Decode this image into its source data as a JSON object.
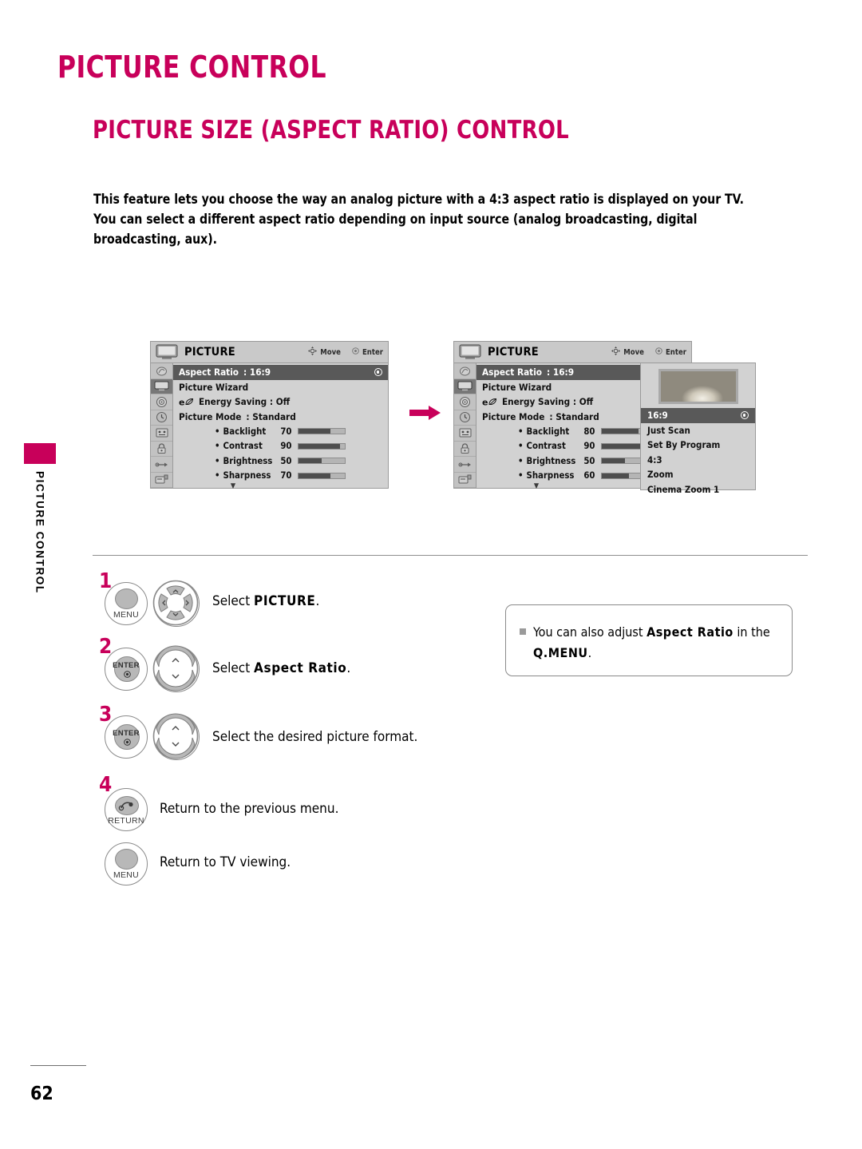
{
  "page": {
    "chapter_title": "PICTURE CONTROL",
    "section_title": "PICTURE SIZE (ASPECT RATIO) CONTROL",
    "page_number": "62",
    "side_tab": "PICTURE CONTROL",
    "accent_color": "#C8005A"
  },
  "intro": {
    "line1": "This feature lets you choose the way an analog picture with a 4:3 aspect ratio is displayed on your TV.",
    "line2": "You can select a different aspect ratio depending on input source (analog broadcasting, digital broadcasting, aux)."
  },
  "osd1": {
    "title": "PICTURE",
    "hint_move": "Move",
    "hint_enter": "Enter",
    "rows": [
      {
        "label": "Aspect Ratio",
        "value": ": 16:9",
        "selected": true
      },
      {
        "label": "Picture Wizard",
        "value": "",
        "selected": false
      },
      {
        "label": "Energy Saving : Off",
        "value": "",
        "selected": false,
        "eco": true
      },
      {
        "label": "Picture Mode",
        "value": ": Standard",
        "selected": false
      }
    ],
    "sliders": [
      {
        "name": "Backlight",
        "value": "70",
        "percent": 70
      },
      {
        "name": "Contrast",
        "value": "90",
        "percent": 90
      },
      {
        "name": "Brightness",
        "value": "50",
        "percent": 50
      },
      {
        "name": "Sharpness",
        "value": "70",
        "percent": 70
      }
    ],
    "more_indicator": "▼",
    "sidebar_icons": [
      "channel-icon",
      "picture-icon",
      "audio-icon",
      "time-icon",
      "option-icon",
      "lock-icon",
      "input-icon",
      "usb-icon"
    ]
  },
  "osd2": {
    "title": "PICTURE",
    "hint_move": "Move",
    "hint_enter": "Enter",
    "rows": [
      {
        "label": "Aspect Ratio",
        "value": ": 16:9",
        "selected": true
      },
      {
        "label": "Picture Wizard",
        "value": "",
        "selected": false
      },
      {
        "label": "Energy Saving : Off",
        "value": "",
        "selected": false,
        "eco": true
      },
      {
        "label": "Picture Mode",
        "value": ": Standard",
        "selected": false
      }
    ],
    "sliders": [
      {
        "name": "Backlight",
        "value": "80",
        "percent": 80
      },
      {
        "name": "Contrast",
        "value": "90",
        "percent": 90
      },
      {
        "name": "Brightness",
        "value": "50",
        "percent": 50
      },
      {
        "name": "Sharpness",
        "value": "60",
        "percent": 60
      }
    ],
    "more_indicator": "▼",
    "dropdown": {
      "options": [
        {
          "label": "16:9",
          "selected": true
        },
        {
          "label": "Just Scan",
          "selected": false
        },
        {
          "label": "Set By Program",
          "selected": false
        },
        {
          "label": "4:3",
          "selected": false
        },
        {
          "label": "Zoom",
          "selected": false
        },
        {
          "label": "Cinema Zoom 1",
          "selected": false
        }
      ]
    }
  },
  "steps": [
    {
      "number": "1",
      "button_label": "MENU",
      "nav": "four-way",
      "text_plain_before": "Select ",
      "text_bold": "PICTURE",
      "text_plain_after": "."
    },
    {
      "number": "2",
      "button_label": "ENTER",
      "nav": "up-down",
      "text_plain_before": "Select ",
      "text_bold": "Aspect Ratio",
      "text_plain_after": "."
    },
    {
      "number": "3",
      "button_label": "ENTER",
      "nav": "up-down",
      "text_plain_before": "Select the desired picture format.",
      "text_bold": "",
      "text_plain_after": ""
    },
    {
      "number": "4",
      "button_label": "RETURN",
      "nav": "none",
      "text_plain_before": "Return to the previous menu.",
      "text_bold": "",
      "text_plain_after": ""
    },
    {
      "number": "",
      "button_label": "MENU",
      "nav": "none",
      "text_plain_before": "Return to TV viewing.",
      "text_bold": "",
      "text_plain_after": ""
    }
  ],
  "note": {
    "part1": "You can also adjust ",
    "bold1": "Aspect Ratio",
    "part2": " in the ",
    "bold2": "Q.MENU",
    "part3": "."
  }
}
